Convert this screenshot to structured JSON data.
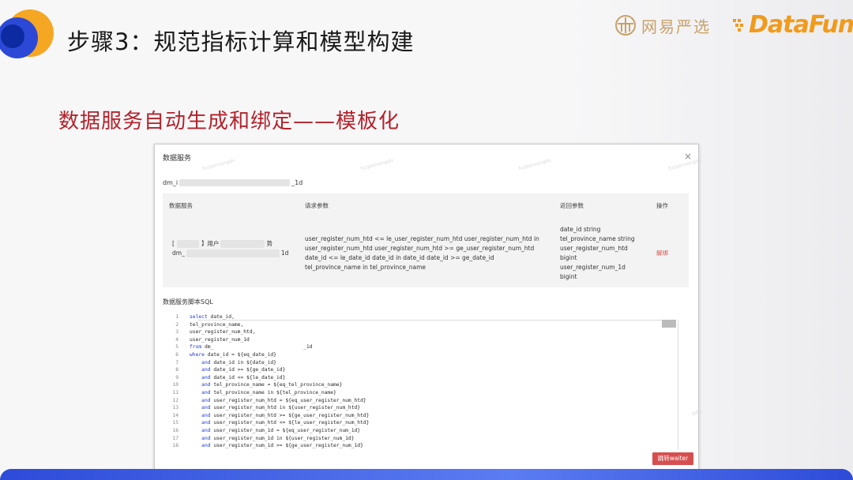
{
  "slide": {
    "title": "步骤3：规范指标计算和模型构建",
    "subtitle": "数据服务自动生成和绑定——模板化",
    "brand1": "网易严选",
    "brand2": "DataFun."
  },
  "dialog": {
    "title": "数据服务",
    "close_icon": "×",
    "service_name_prefix": "dm_i",
    "service_name_suffix": "_1d",
    "table": {
      "headers": [
        "数据服务",
        "请求参数",
        "返回参数",
        "操作"
      ],
      "row": {
        "service_line1_a": "[",
        "service_line1_b": "】用户",
        "service_line1_c": "势",
        "service_line2_a": "dm_",
        "service_line2_b": "1d",
        "request_params": [
          "user_register_num_htd <= le_user_register_num_htd user_register_num_htd in",
          "user_register_num_htd user_register_num_htd >= ge_user_register_num_htd",
          "date_id <= le_date_id date_id in date_id date_id >= ge_date_id",
          "tel_province_name in tel_province_name"
        ],
        "return_params": [
          "date_id string",
          "tel_province_name string",
          "user_register_num_htd",
          "bigint",
          "user_register_num_1d",
          "bigint"
        ],
        "action": "解绑"
      }
    },
    "sql_label": "数据服务脚本SQL",
    "sql_lines": [
      {
        "n": "1",
        "kw": "select",
        "rest": " date_id,",
        "indent": ""
      },
      {
        "n": "2",
        "kw": "",
        "rest": "tel_province_name,",
        "indent": ""
      },
      {
        "n": "3",
        "kw": "",
        "rest": "user_register_num_htd,",
        "indent": ""
      },
      {
        "n": "4",
        "kw": "",
        "rest": "user_register_num_1d",
        "indent": ""
      },
      {
        "n": "5",
        "kw": "from",
        "rest": " dm_                              _1d",
        "indent": ""
      },
      {
        "n": "6",
        "kw": "where",
        "rest": " date_id = ${eq_date_id}",
        "indent": ""
      },
      {
        "n": "7",
        "kw": "and",
        "rest": " date_id in ${date_id}",
        "indent": "    "
      },
      {
        "n": "8",
        "kw": "and",
        "rest": " date_id >= ${ge_date_id}",
        "indent": "    "
      },
      {
        "n": "9",
        "kw": "and",
        "rest": " date_id <= ${le_date_id}",
        "indent": "    "
      },
      {
        "n": "10",
        "kw": "and",
        "rest": " tel_province_name = ${eq_tel_province_name}",
        "indent": "    "
      },
      {
        "n": "11",
        "kw": "and",
        "rest": " tel_province_name in ${tel_province_name}",
        "indent": "    "
      },
      {
        "n": "12",
        "kw": "and",
        "rest": " user_register_num_htd = ${eq_user_register_num_htd}",
        "indent": "    "
      },
      {
        "n": "13",
        "kw": "and",
        "rest": " user_register_num_htd in ${user_register_num_htd}",
        "indent": "    "
      },
      {
        "n": "14",
        "kw": "and",
        "rest": " user_register_num_htd >= ${ge_user_register_num_htd}",
        "indent": "    "
      },
      {
        "n": "15",
        "kw": "and",
        "rest": " user_register_num_htd <= ${le_user_register_num_htd}",
        "indent": "    "
      },
      {
        "n": "16",
        "kw": "and",
        "rest": " user_register_num_1d = ${eq_user_register_num_1d}",
        "indent": "    "
      },
      {
        "n": "17",
        "kw": "and",
        "rest": " user_register_num_1d in ${user_register_num_1d}",
        "indent": "    "
      },
      {
        "n": "18",
        "kw": "and",
        "rest": " user_register_num_1d >= ${ge_user_register_num_1d}",
        "indent": "    "
      }
    ],
    "jump_button": "跳转waiter",
    "watermark": "fuzpanxongdu"
  }
}
